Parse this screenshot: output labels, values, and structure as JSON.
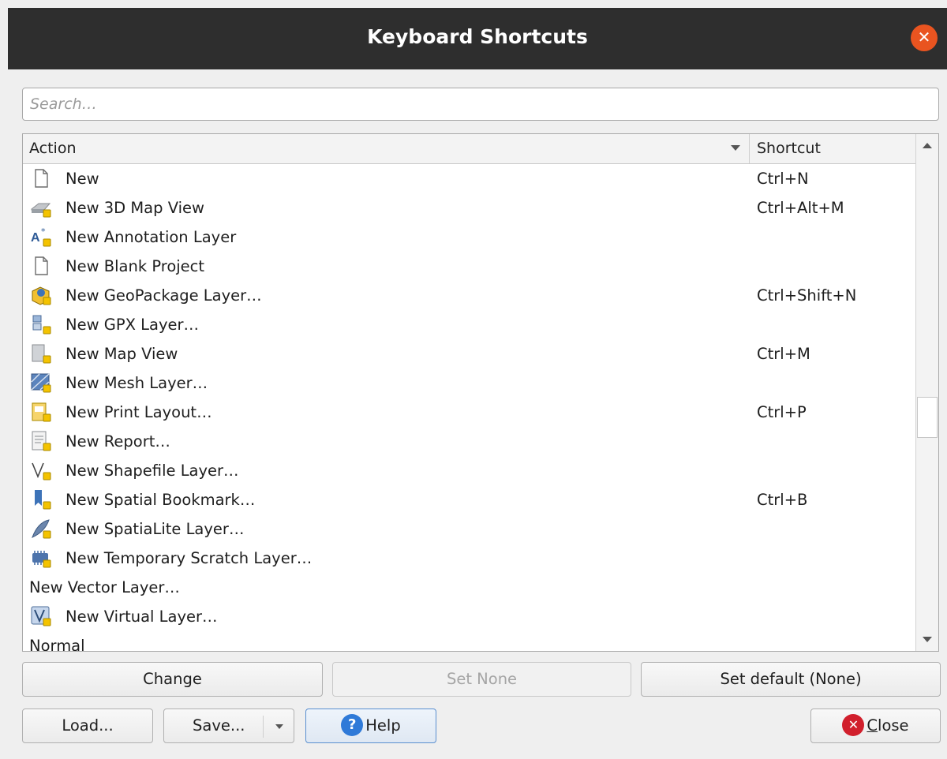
{
  "window": {
    "title": "Keyboard Shortcuts",
    "close_glyph": "✕"
  },
  "search": {
    "placeholder": "Search…",
    "value": ""
  },
  "table": {
    "columns": [
      "Action",
      "Shortcut"
    ],
    "rows": [
      {
        "icon": "document-icon",
        "action": "New",
        "shortcut": "Ctrl+N"
      },
      {
        "icon": "3d-map-view-icon",
        "action": "New 3D Map View",
        "shortcut": "Ctrl+Alt+M"
      },
      {
        "icon": "annotation-layer-icon",
        "action": "New Annotation Layer",
        "shortcut": ""
      },
      {
        "icon": "document-icon",
        "action": "New Blank Project",
        "shortcut": ""
      },
      {
        "icon": "geopackage-icon",
        "action": "New GeoPackage Layer…",
        "shortcut": "Ctrl+Shift+N"
      },
      {
        "icon": "gpx-layer-icon",
        "action": "New GPX Layer…",
        "shortcut": ""
      },
      {
        "icon": "map-view-icon",
        "action": "New Map View",
        "shortcut": "Ctrl+M"
      },
      {
        "icon": "mesh-layer-icon",
        "action": "New Mesh Layer…",
        "shortcut": ""
      },
      {
        "icon": "print-layout-icon",
        "action": "New Print Layout…",
        "shortcut": "Ctrl+P"
      },
      {
        "icon": "report-icon",
        "action": "New Report…",
        "shortcut": ""
      },
      {
        "icon": "shapefile-icon",
        "action": "New Shapefile Layer…",
        "shortcut": ""
      },
      {
        "icon": "bookmark-icon",
        "action": "New Spatial Bookmark…",
        "shortcut": "Ctrl+B"
      },
      {
        "icon": "spatialite-icon",
        "action": "New SpatiaLite Layer…",
        "shortcut": ""
      },
      {
        "icon": "scratch-layer-icon",
        "action": "New Temporary Scratch Layer…",
        "shortcut": ""
      },
      {
        "icon": "",
        "action": "New Vector Layer…",
        "shortcut": ""
      },
      {
        "icon": "virtual-layer-icon",
        "action": "New Virtual Layer…",
        "shortcut": ""
      },
      {
        "icon": "",
        "action": "Normal",
        "shortcut": ""
      }
    ]
  },
  "buttons": {
    "change": "Change",
    "set_none": "Set None",
    "set_default": "Set default (None)",
    "load": "Load...",
    "save": "Save...",
    "help": "Help",
    "close_first": "C",
    "close_rest": "lose"
  },
  "colors": {
    "titlebar": "#2e2e2e",
    "close_accent": "#e95420",
    "help_icon": "#2f7ad8",
    "close_icon": "#d11f2c"
  }
}
